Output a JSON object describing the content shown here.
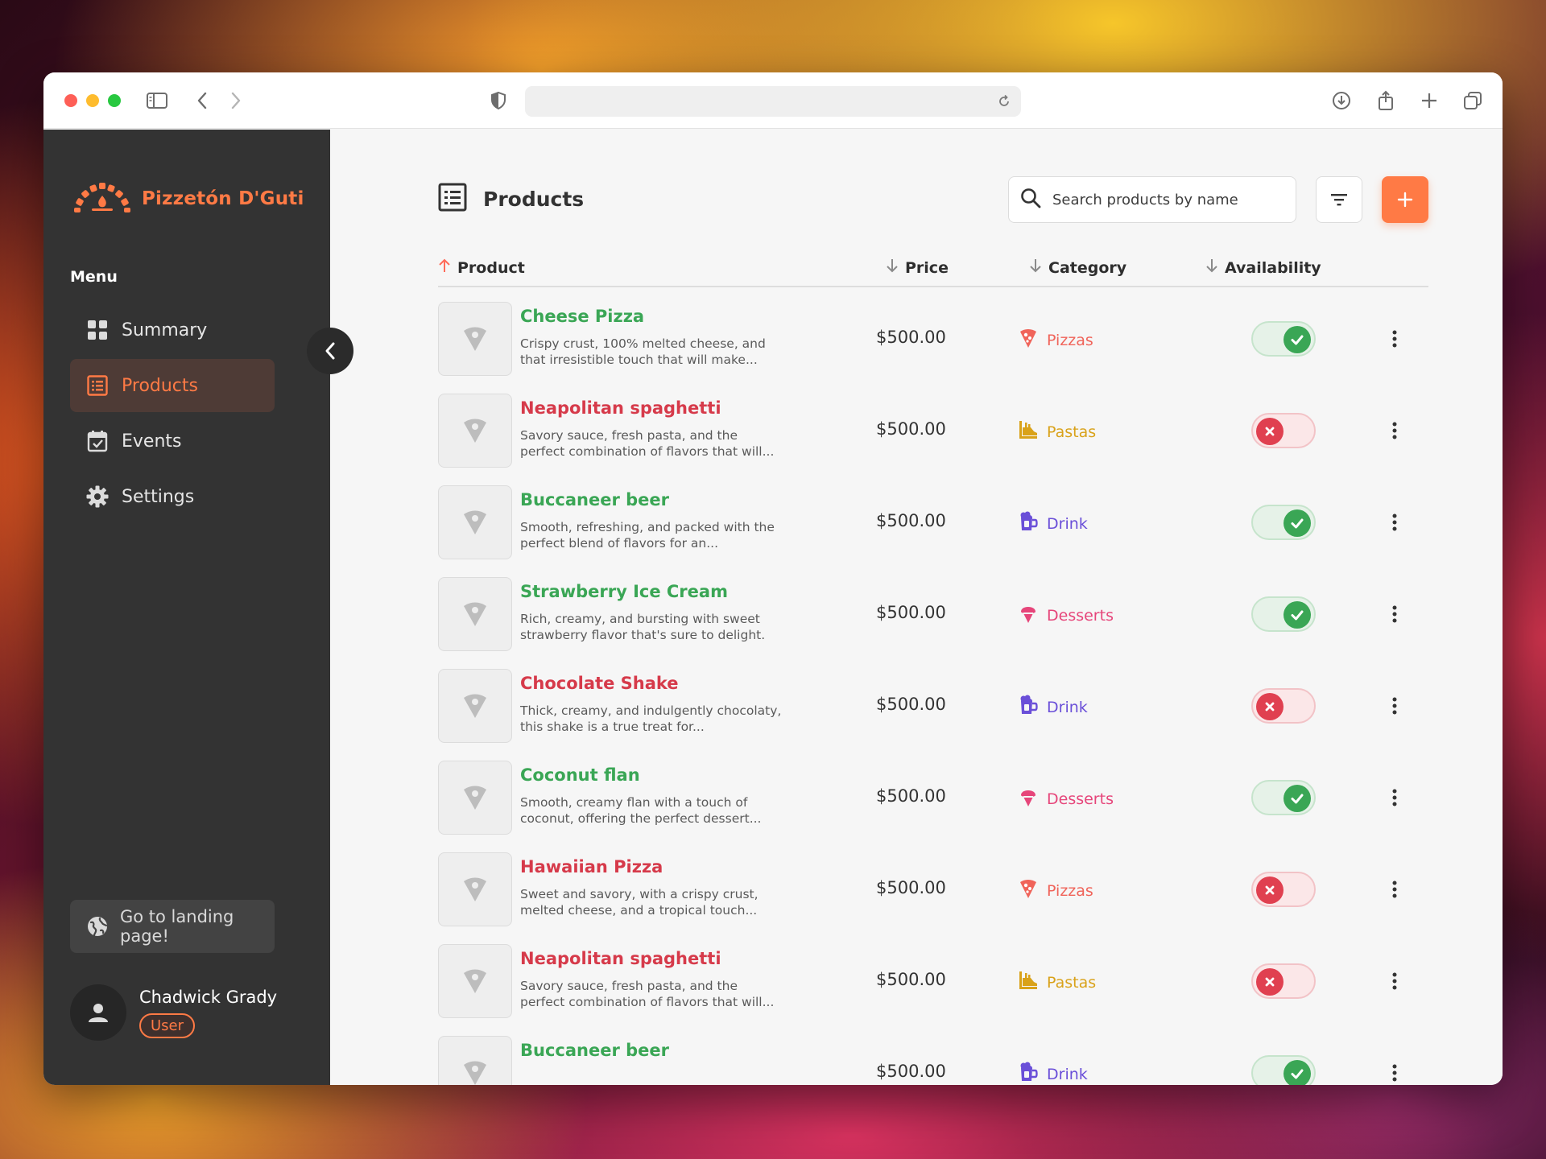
{
  "app": {
    "brand": "Pizzetón D'Guti",
    "accent": "#ff7a45"
  },
  "sidebar": {
    "menu_label": "Menu",
    "items": [
      {
        "label": "Summary",
        "icon": "grid-icon"
      },
      {
        "label": "Products",
        "icon": "list-icon",
        "active": true
      },
      {
        "label": "Events",
        "icon": "calendar-check-icon"
      },
      {
        "label": "Settings",
        "icon": "gear-icon"
      }
    ],
    "landing_label": "Go to landing page!",
    "user": {
      "name": "Chadwick Grady",
      "role": "User"
    }
  },
  "header": {
    "title": "Products",
    "search_placeholder": "Search products by name"
  },
  "table": {
    "columns": [
      "Product",
      "Price",
      "Category",
      "Availability"
    ],
    "rows": [
      {
        "name": "Cheese Pizza",
        "desc": "Crispy crust, 100% melted cheese, and that irresistible touch that will make...",
        "price": "$500.00",
        "category": "Pizzas",
        "available": true
      },
      {
        "name": "Neapolitan spaghetti",
        "desc": "Savory sauce, fresh pasta, and the perfect combination of flavors that will...",
        "price": "$500.00",
        "category": "Pastas",
        "available": false
      },
      {
        "name": "Buccaneer beer",
        "desc": "Smooth, refreshing, and packed with the perfect blend of flavors for an...",
        "price": "$500.00",
        "category": "Drink",
        "available": true
      },
      {
        "name": "Strawberry Ice Cream",
        "desc": "Rich, creamy, and bursting with sweet strawberry flavor that's sure to delight.",
        "price": "$500.00",
        "category": "Desserts",
        "available": true
      },
      {
        "name": "Chocolate Shake",
        "desc": "Thick, creamy, and indulgently chocolaty, this shake is a true treat for...",
        "price": "$500.00",
        "category": "Drink",
        "available": false
      },
      {
        "name": "Coconut flan",
        "desc": "Smooth, creamy flan with a touch of coconut, offering the perfect dessert...",
        "price": "$500.00",
        "category": "Desserts",
        "available": true
      },
      {
        "name": "Hawaiian Pizza",
        "desc": "Sweet and savory, with a crispy crust, melted cheese, and a tropical touch...",
        "price": "$500.00",
        "category": "Pizzas",
        "available": false
      },
      {
        "name": "Neapolitan spaghetti",
        "desc": "Savory sauce, fresh pasta, and the perfect combination of flavors that will...",
        "price": "$500.00",
        "category": "Pastas",
        "available": false
      },
      {
        "name": "Buccaneer beer",
        "desc": "",
        "price": "$500.00",
        "category": "Drink",
        "available": true
      }
    ]
  },
  "category_colors": {
    "Pizzas": "#f0645a",
    "Pastas": "#d9a21a",
    "Drink": "#6a4fd8",
    "Desserts": "#e6457a"
  }
}
